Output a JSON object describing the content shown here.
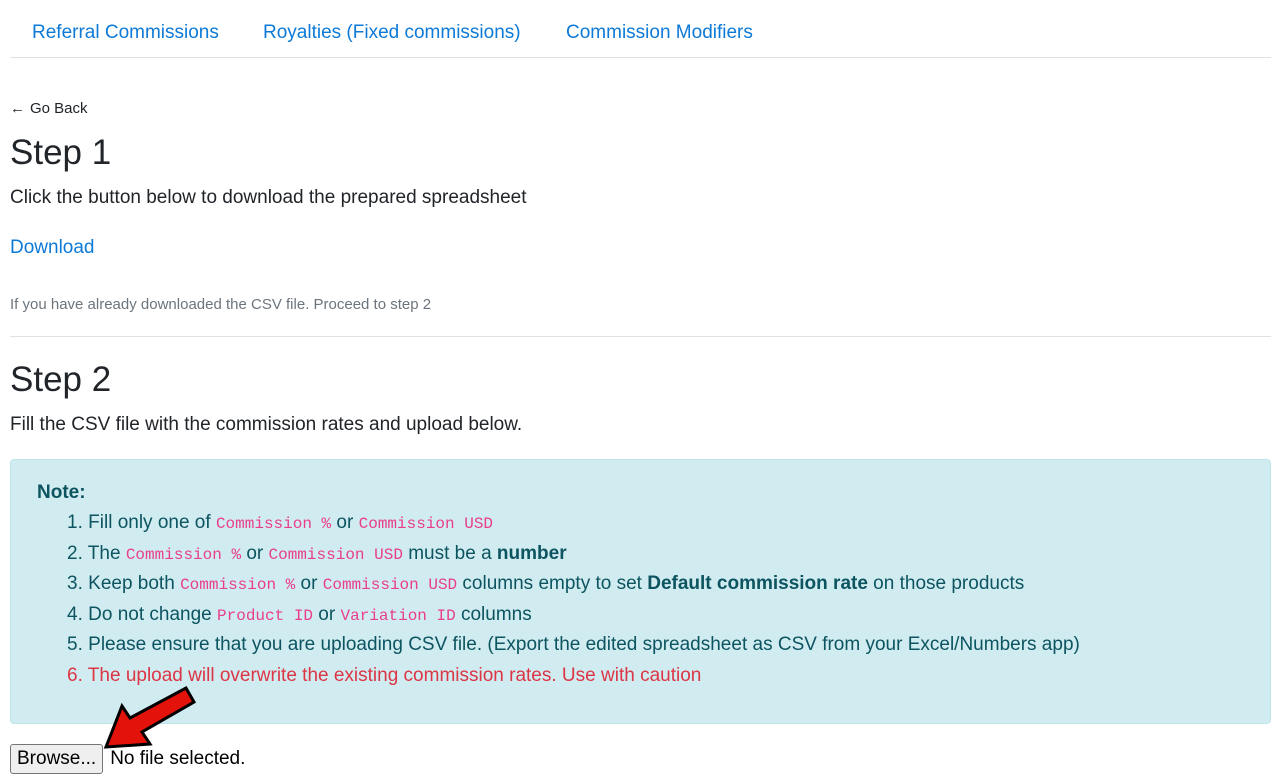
{
  "tabs": [
    {
      "label": "Referral Commissions"
    },
    {
      "label": "Royalties (Fixed commissions)"
    },
    {
      "label": "Commission Modifiers"
    }
  ],
  "go_back": {
    "arrow": "←",
    "label": "Go Back"
  },
  "step1": {
    "title": "Step 1",
    "instruction": "Click the button below to download the prepared spreadsheet",
    "download_label": "Download",
    "note": "If you have already downloaded the CSV file. Proceed to step 2"
  },
  "step2": {
    "title": "Step 2",
    "instruction": "Fill the CSV file with the commission rates and upload below."
  },
  "note_box": {
    "title": "Note:",
    "items": [
      {
        "num": "1.",
        "t1": "Fill only one of ",
        "c1": "Commission %",
        "t2": " or ",
        "c2": "Commission USD"
      },
      {
        "num": "2.",
        "t1": "The ",
        "c1": "Commission %",
        "t2": " or ",
        "c2": "Commission USD",
        "t3": " must be a ",
        "b1": "number"
      },
      {
        "num": "3.",
        "t1": "Keep both ",
        "c1": "Commission %",
        "t2": " or ",
        "c2": "Commission USD",
        "t3": " columns empty to set ",
        "b1": "Default commission rate",
        "t4": " on those products"
      },
      {
        "num": "4.",
        "t1": "Do not change ",
        "c1": "Product ID",
        "t2": " or ",
        "c2": "Variation ID",
        "t3": " columns"
      },
      {
        "num": "5.",
        "t1": "Please ensure that you are uploading CSV file. (Export the edited spreadsheet as CSV from your Excel/Numbers app)"
      },
      {
        "num": "6.",
        "t1": "The upload will overwrite the existing commission rates. Use with caution"
      }
    ]
  },
  "file_input": {
    "button_label": "Browse...",
    "status": "No file selected."
  },
  "colors": {
    "link": "#0d7ad8",
    "alert_bg": "#d1ecf1",
    "alert_text": "#0c5460",
    "code": "#e83e8c",
    "danger": "#dc3545",
    "annotation_arrow": "#e3120b"
  },
  "icons": {
    "back": "left-arrow-icon",
    "annotation": "red-arrow-icon"
  }
}
